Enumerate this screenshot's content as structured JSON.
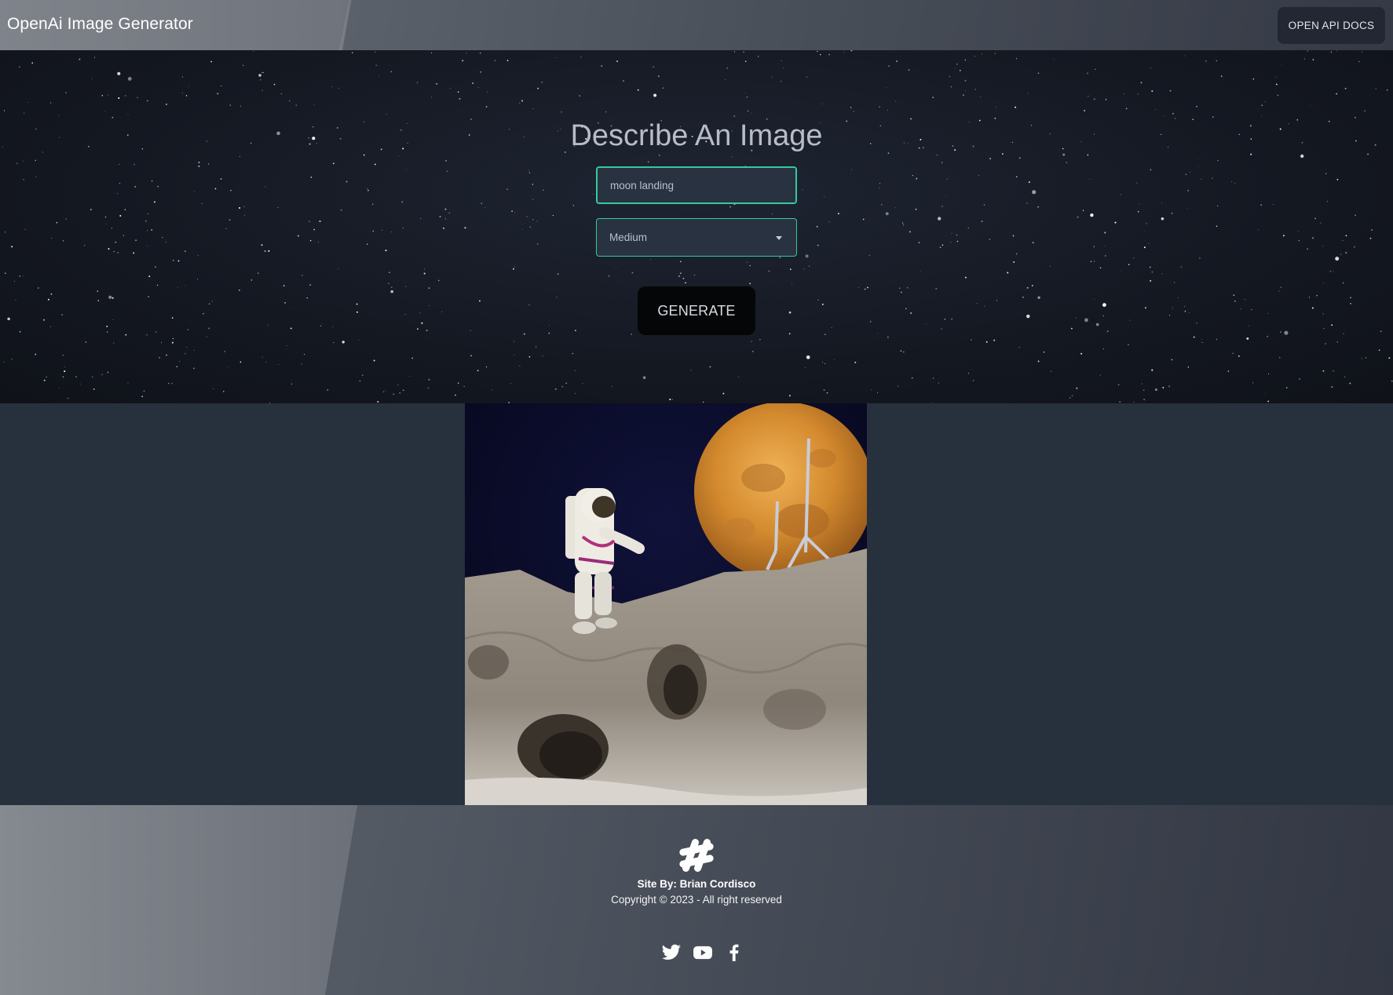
{
  "navbar": {
    "brand": "OpenAi Image Generator",
    "docs_button": "OPEN API DOCS"
  },
  "hero": {
    "title": "Describe An Image",
    "prompt_value": "moon landing",
    "size_selected": "Medium",
    "generate_label": "GENERATE"
  },
  "result": {
    "description_icon": "generated-image"
  },
  "footer": {
    "logo_icon": "hash-icon",
    "site_by": "Site By: Brian Cordisco",
    "copyright": "Copyright © 2023 - All right reserved",
    "socials": [
      "twitter-icon",
      "youtube-icon",
      "facebook-icon"
    ]
  },
  "colors": {
    "accent": "#36c8a0",
    "page_bg": "#27303d",
    "button_dark": "#050608"
  }
}
